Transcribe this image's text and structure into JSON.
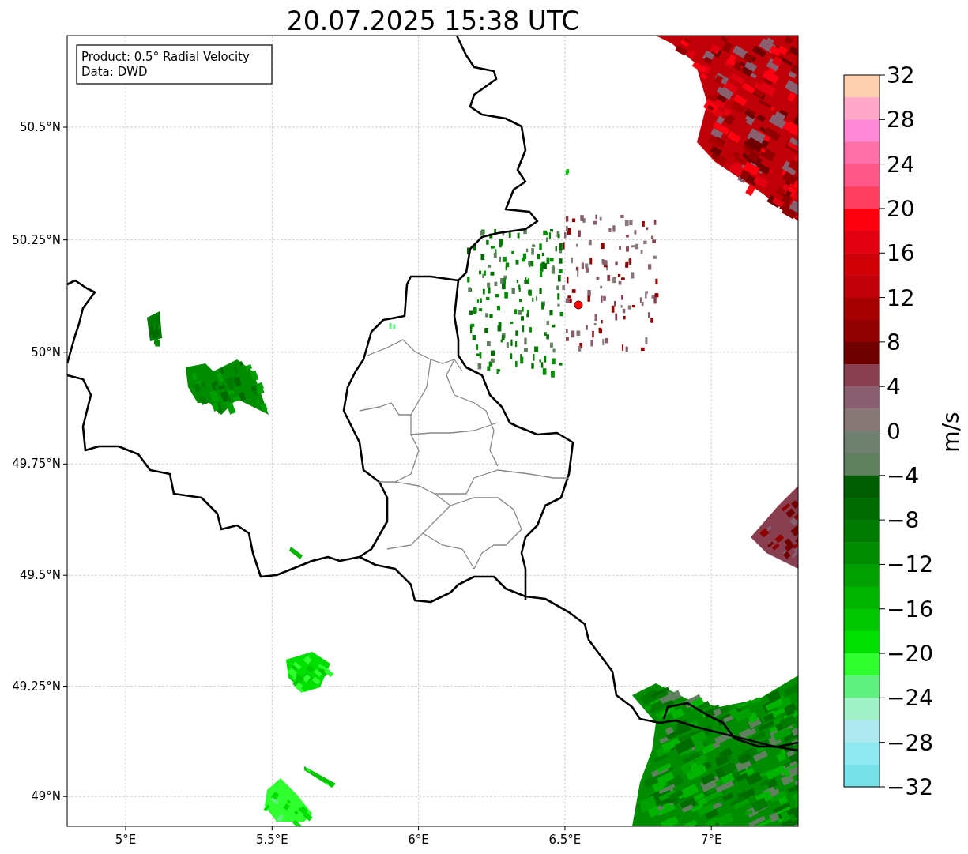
{
  "title": "20.07.2025 15:38 UTC",
  "info_box": [
    "Product: 0.5° Radial Velocity",
    "Data: DWD"
  ],
  "x_axis": {
    "ticks": [
      "5°E",
      "5.5°E",
      "6°E",
      "6.5°E",
      "7°E"
    ]
  },
  "y_axis": {
    "ticks": [
      "50.5°N",
      "50.25°N",
      "50°N",
      "49.75°N",
      "49.5°N",
      "49.25°N",
      "49°N"
    ]
  },
  "colorbar": {
    "label": "m/s",
    "ticks": [
      "32",
      "28",
      "24",
      "20",
      "16",
      "12",
      "8",
      "4",
      "0",
      "−4",
      "−8",
      "−12",
      "−16",
      "−20",
      "−24",
      "−28",
      "−32"
    ],
    "bins": [
      {
        "color": "#ffd0b0"
      },
      {
        "color": "#ffa8c8"
      },
      {
        "color": "#ff88d8"
      },
      {
        "color": "#ff70a8"
      },
      {
        "color": "#ff5888"
      },
      {
        "color": "#ff4060"
      },
      {
        "color": "#ff0010"
      },
      {
        "color": "#e00010"
      },
      {
        "color": "#d00008"
      },
      {
        "color": "#c00008"
      },
      {
        "color": "#a80000"
      },
      {
        "color": "#900000"
      },
      {
        "color": "#700000"
      },
      {
        "color": "#884050"
      },
      {
        "color": "#886070"
      },
      {
        "color": "#887878"
      },
      {
        "color": "#708070"
      },
      {
        "color": "#608060"
      },
      {
        "color": "#005c00"
      },
      {
        "color": "#006c00"
      },
      {
        "color": "#007a00"
      },
      {
        "color": "#008c00"
      },
      {
        "color": "#00a000"
      },
      {
        "color": "#00b400"
      },
      {
        "color": "#00c800"
      },
      {
        "color": "#00e000"
      },
      {
        "color": "#30ff30"
      },
      {
        "color": "#60f080"
      },
      {
        "color": "#a0f0c8"
      },
      {
        "color": "#b0e8f0"
      },
      {
        "color": "#90e8f0"
      },
      {
        "color": "#78e0e8"
      }
    ]
  }
}
